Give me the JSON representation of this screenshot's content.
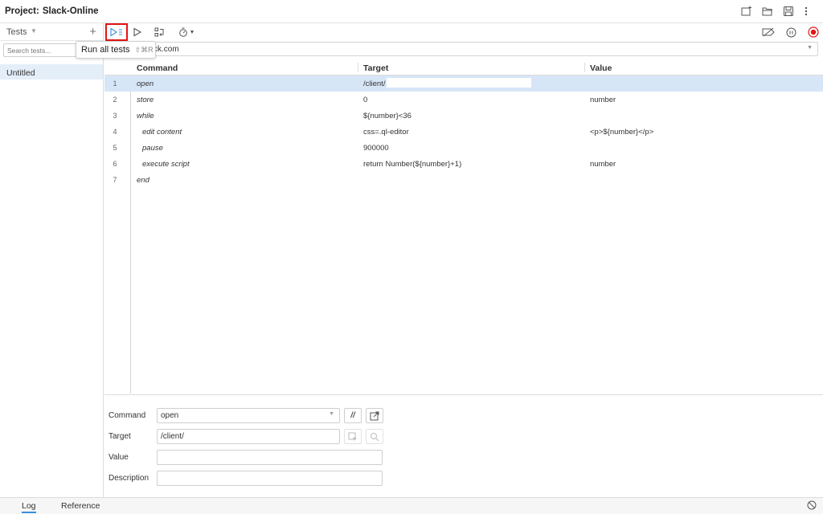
{
  "project": {
    "label": "Project:",
    "name": "Slack-Online"
  },
  "sidebar": {
    "section_label": "Tests",
    "add_label": "+",
    "search_placeholder": "Search tests...",
    "tests": [
      {
        "label": "Untitled"
      }
    ]
  },
  "toolbar": {
    "tooltip": {
      "label": "Run all tests",
      "shortcut": "⇧⌘R"
    }
  },
  "url_bar": {
    "value": "ck.com"
  },
  "grid": {
    "headers": {
      "command": "Command",
      "target": "Target",
      "value": "Value"
    },
    "rows": [
      {
        "num": "1",
        "command": "open",
        "target": "/client/",
        "value": ""
      },
      {
        "num": "2",
        "command": "store",
        "target": "0",
        "value": "number"
      },
      {
        "num": "3",
        "command": "while",
        "target": "${number}<36",
        "value": ""
      },
      {
        "num": "4",
        "command": "edit content",
        "target": "css=.ql-editor",
        "value": "<p>${number}</p>"
      },
      {
        "num": "5",
        "command": "pause",
        "target": "900000",
        "value": ""
      },
      {
        "num": "6",
        "command": "execute script",
        "target": "return Number(${number}+1)",
        "value": "number"
      },
      {
        "num": "7",
        "command": "end",
        "target": "",
        "value": ""
      }
    ]
  },
  "editor": {
    "command_label": "Command",
    "command_value": "open",
    "comment_button": "//",
    "target_label": "Target",
    "target_value": "/client/",
    "value_label": "Value",
    "value_value": "",
    "description_label": "Description",
    "description_value": ""
  },
  "bottom_tabs": [
    {
      "label": "Log"
    },
    {
      "label": "Reference"
    }
  ],
  "colors": {
    "accent": "#3b8de0",
    "highlight_box": "#e31414",
    "selected_row": "#d7e6f7",
    "rec": "#e31414"
  }
}
